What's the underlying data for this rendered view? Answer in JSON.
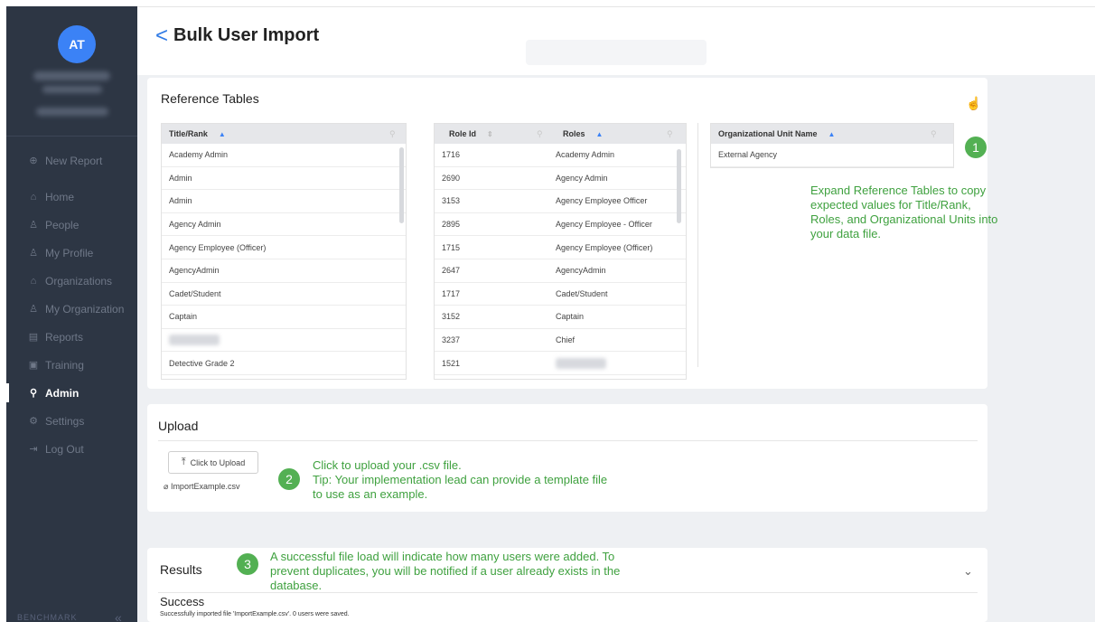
{
  "sidebar": {
    "avatar_initials": "AT",
    "nav": [
      {
        "label": "New Report",
        "icon": "plus-circle-icon",
        "glyph": "⊕",
        "active": false
      },
      {
        "label": "Home",
        "icon": "home-icon",
        "glyph": "⌂",
        "active": false
      },
      {
        "label": "People",
        "icon": "people-icon",
        "glyph": "♙",
        "active": false
      },
      {
        "label": "My Profile",
        "icon": "profile-icon",
        "glyph": "♙",
        "active": false
      },
      {
        "label": "Organizations",
        "icon": "organizations-icon",
        "glyph": "⌂",
        "active": false
      },
      {
        "label": "My Organization",
        "icon": "organization-icon",
        "glyph": "♙",
        "active": false
      },
      {
        "label": "Reports",
        "icon": "reports-icon",
        "glyph": "▤",
        "active": false
      },
      {
        "label": "Training",
        "icon": "training-icon",
        "glyph": "▣",
        "active": false
      },
      {
        "label": "Admin",
        "icon": "search-icon",
        "glyph": "⚲",
        "active": true
      },
      {
        "label": "Settings",
        "icon": "gear-icon",
        "glyph": "⚙",
        "active": false
      },
      {
        "label": "Log Out",
        "icon": "logout-icon",
        "glyph": "⇥",
        "active": false
      }
    ],
    "brand": "BENCHMARK",
    "collapse_glyph": "«"
  },
  "header": {
    "back_glyph": "<",
    "title": "Bulk User Import"
  },
  "reference": {
    "title": "Reference Tables",
    "title_rank": {
      "header": "Title/Rank",
      "rows": [
        "Academy Admin",
        "Admin",
        "Admin",
        "Agency Admin",
        "Agency Employee (Officer)",
        "AgencyAdmin",
        "Cadet/Student",
        "Captain",
        "",
        "Detective Grade 2"
      ]
    },
    "roles": {
      "header_id": "Role Id",
      "header_role": "Roles",
      "rows": [
        {
          "id": "1716",
          "role": "Academy Admin"
        },
        {
          "id": "2690",
          "role": "Agency Admin"
        },
        {
          "id": "3153",
          "role": "Agency Employee Officer"
        },
        {
          "id": "2895",
          "role": "Agency Employee - Officer"
        },
        {
          "id": "1715",
          "role": "Agency Employee (Officer)"
        },
        {
          "id": "2647",
          "role": "AgencyAdmin"
        },
        {
          "id": "1717",
          "role": "Cadet/Student"
        },
        {
          "id": "3152",
          "role": "Captain"
        },
        {
          "id": "3237",
          "role": "Chief"
        },
        {
          "id": "1521",
          "role": ""
        }
      ]
    },
    "org_units": {
      "header": "Organizational Unit Name",
      "rows": [
        "External Agency"
      ]
    },
    "annotation_number": "1",
    "annotation": "Expand Reference Tables to copy expected values for Title/Rank, Roles, and Organizational Units into your data file."
  },
  "upload": {
    "title": "Upload",
    "button_label": "Click to Upload",
    "file_name": "ImportExample.csv",
    "annotation_number": "2",
    "annotation_line1": "Click to upload your .csv file.",
    "annotation_line2": "Tip: Your implementation lead can provide a template file to use as an example."
  },
  "results": {
    "title": "Results",
    "annotation_number": "3",
    "annotation": "A successful file load will indicate how many users were added. To prevent duplicates, you will be notified if a user already exists in the database.",
    "status": "Success",
    "message": "Successfully imported file 'ImportExample.csv'. 0 users were saved.",
    "chevron": "⌄"
  }
}
